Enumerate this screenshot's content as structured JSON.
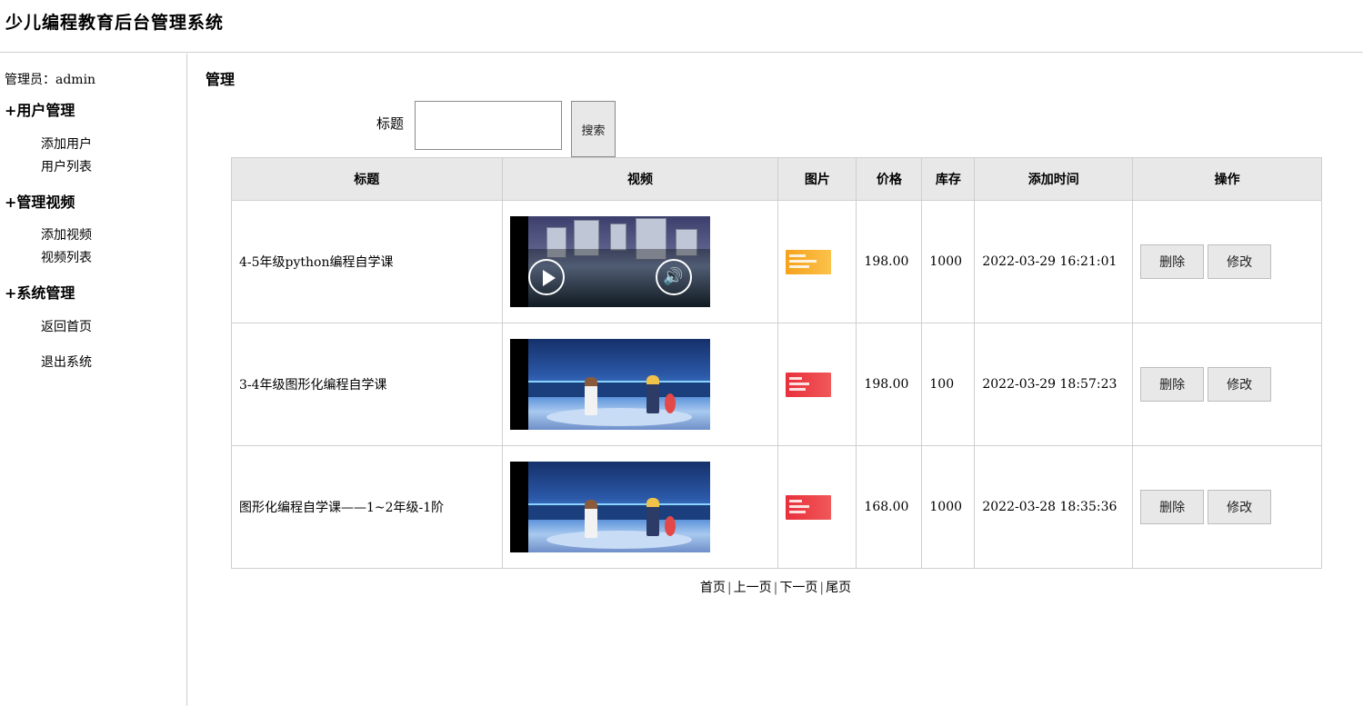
{
  "header": {
    "title": "少儿编程教育后台管理系统"
  },
  "sidebar": {
    "admin": "管理员：admin",
    "groups": [
      {
        "label": "+用户管理",
        "items": [
          {
            "label": "添加用户"
          },
          {
            "label": "用户列表"
          }
        ]
      },
      {
        "label": "+管理视频",
        "items": [
          {
            "label": "添加视频"
          },
          {
            "label": "视频列表"
          }
        ]
      },
      {
        "label": "+系统管理",
        "items": [
          {
            "label": "返回首页"
          },
          {
            "label": "退出系统"
          }
        ]
      }
    ]
  },
  "main": {
    "title": "管理",
    "search": {
      "label": "标题",
      "value": "",
      "button": "搜索"
    },
    "table": {
      "headers": [
        "标题",
        "视频",
        "图片",
        "价格",
        "库存",
        "添加时间",
        "操作"
      ],
      "rows": [
        {
          "title": "4-5年级python编程自学课",
          "price": "198.00",
          "stock": "1000",
          "time": "2022-03-29 16:21:01",
          "delete": "删除",
          "edit": "修改"
        },
        {
          "title": "3-4年级图形化编程自学课",
          "price": "198.00",
          "stock": "100",
          "time": "2022-03-29 18:57:23",
          "delete": "删除",
          "edit": "修改"
        },
        {
          "title": "图形化编程自学课——1~2年级-1阶",
          "price": "168.00",
          "stock": "1000",
          "time": "2022-03-28 18:35:36",
          "delete": "删除",
          "edit": "修改"
        }
      ]
    },
    "pager": {
      "first": "首页",
      "prev": "上一页",
      "next": "下一页",
      "last": "尾页",
      "separator": "|"
    }
  },
  "icons": {
    "play": "play-icon",
    "volume": "volume-icon"
  }
}
